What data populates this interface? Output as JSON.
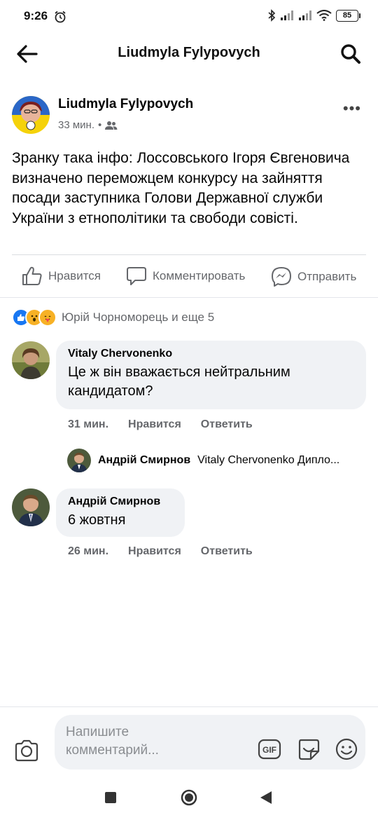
{
  "status_bar": {
    "time": "9:26",
    "battery": "85",
    "icons": [
      "alarm-icon",
      "bluetooth-icon",
      "signal-icon",
      "signal-icon",
      "wifi-icon",
      "battery-icon"
    ]
  },
  "header": {
    "title": "Liudmyla Fylypovych",
    "back_icon": "arrow-left-icon",
    "search_icon": "search-icon"
  },
  "post": {
    "author": "Liudmyla Fylypovych",
    "time": "33 мин.",
    "separator": "•",
    "audience_icon": "friends-icon",
    "more_label": "•••",
    "text": "Зранку така інфо: Лоссовського Ігоря Євгеновича визначено переможцем конкурсу на зайняття посади заступника Голови Державної служби України з етнополітики та свободи совісті."
  },
  "actions": {
    "like": "Нравится",
    "comment": "Комментировать",
    "share": "Отправить"
  },
  "reactions": {
    "icons": [
      "like-reaction-icon",
      "wow-reaction-icon",
      "care-reaction-icon"
    ],
    "summary": "Юрій Чорноморець и еще 5",
    "colors": {
      "like": "#1877f2",
      "wow": "#f7b125"
    }
  },
  "comments": [
    {
      "author": "Vitaly Chervonenko",
      "text": "Це ж він вважається нейтральним кандидатом?",
      "time": "31 мин.",
      "like": "Нравится",
      "reply": "Ответить",
      "reply_preview": {
        "author": "Андрій Смирнов",
        "text": "Vitaly Chervonenko Дипло..."
      }
    },
    {
      "author": "Андрій Смирнов",
      "text": "6 жовтня",
      "time": "26 мин.",
      "like": "Нравится",
      "reply": "Ответить"
    }
  ],
  "composer": {
    "placeholder": "Напишите комментарий...",
    "gif_label": "GIF"
  },
  "navbar": {
    "icons": [
      "square-icon",
      "circle-icon",
      "triangle-back-icon"
    ]
  }
}
